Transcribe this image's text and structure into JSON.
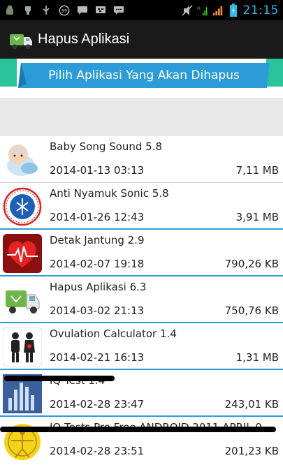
{
  "status_bar": {
    "time": "21:15",
    "left_icons": [
      "android-icon",
      "usb-debug-icon",
      "usb-icon",
      "notification-99-icon",
      "chat-icon",
      "bbm-icon",
      "message-icon"
    ],
    "notification_badge": "99",
    "right_icons": [
      "mute-icon",
      "data-icon",
      "signal-icon",
      "battery-icon"
    ]
  },
  "action_bar": {
    "title": "Hapus Aplikasi"
  },
  "banner": {
    "text": "Pilih Aplikasi Yang Akan Dihapus"
  },
  "colors": {
    "accent_teal": "#29c49a",
    "ribbon_blue": "#2b9cd8",
    "clock_blue": "#33b5e5",
    "action_bar": "#1a1a1a"
  },
  "apps": [
    {
      "name": "Baby Song Sound",
      "version": "5.8",
      "date": "2014-01-13 03:13",
      "size": "7,11 MB",
      "icon": "baby-icon"
    },
    {
      "name": "Anti Nyamuk Sonic",
      "version": "5.8",
      "date": "2014-01-26 12:43",
      "size": "3,91 MB",
      "icon": "mosquito-logo-icon"
    },
    {
      "name": "Detak Jantung",
      "version": "2.9",
      "date": "2014-02-07 19:18",
      "size": "790,26 KB",
      "icon": "heart-icon"
    },
    {
      "name": "Hapus Aplikasi",
      "version": "6.3",
      "date": "2014-03-02 21:13",
      "size": "750,76 KB",
      "icon": "recycle-truck-icon"
    },
    {
      "name": "Ovulation Calculator",
      "version": "1.4",
      "date": "2014-02-21 16:13",
      "size": "1,31 MB",
      "icon": "couple-icon"
    },
    {
      "name": "IQ Test",
      "version": "1.4",
      "date": "2014-02-28 23:47",
      "size": "243,01 KB",
      "icon": "bar-chart-icon"
    },
    {
      "name": "IQ Tests Pro Free ANDROID 2011 APRIL 9",
      "version": "",
      "date": "2014-02-28 23:51",
      "size": "201,23 KB",
      "icon": "vitruvian-icon"
    }
  ]
}
